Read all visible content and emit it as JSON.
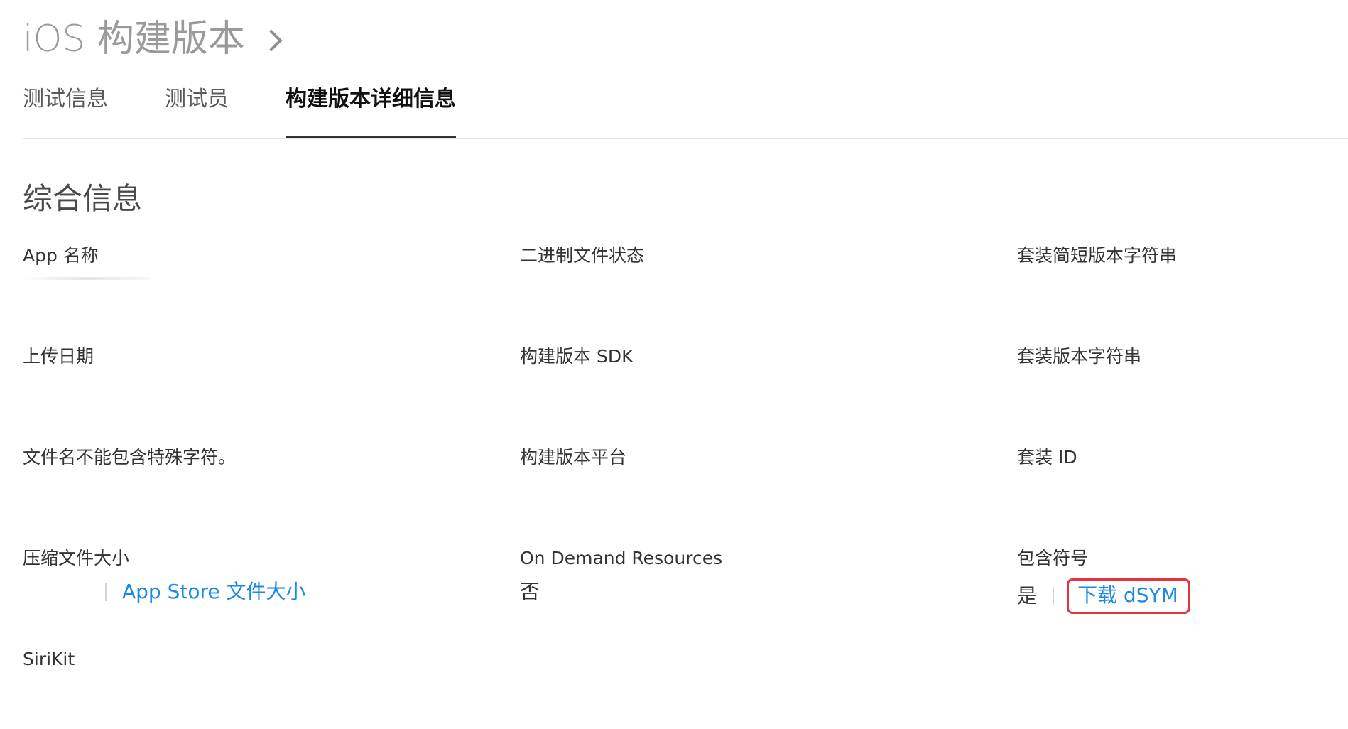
{
  "header": {
    "title": "iOS 构建版本"
  },
  "tabs": [
    {
      "label": "测试信息",
      "active": false
    },
    {
      "label": "测试员",
      "active": false
    },
    {
      "label": "构建版本详细信息",
      "active": true
    }
  ],
  "section": {
    "title": "综合信息"
  },
  "fields": {
    "app_name": {
      "label": "App 名称"
    },
    "binary_state": {
      "label": "二进制文件状态"
    },
    "short_version": {
      "label": "套装简短版本字符串"
    },
    "upload_date": {
      "label": "上传日期"
    },
    "build_sdk": {
      "label": "构建版本 SDK"
    },
    "bundle_version": {
      "label": "套装版本字符串"
    },
    "file_name": {
      "label": "文件名不能包含特殊字符。"
    },
    "build_platform": {
      "label": "构建版本平台"
    },
    "bundle_id": {
      "label": "套装 ID"
    },
    "compressed_size": {
      "label": "压缩文件大小",
      "link": "App Store 文件大小"
    },
    "on_demand": {
      "label": "On Demand Resources",
      "value": "否"
    },
    "symbols": {
      "label": "包含符号",
      "value": "是",
      "link": "下载 dSYM"
    },
    "sirikit": {
      "label": "SiriKit"
    }
  },
  "colors": {
    "link": "#1a8ae5",
    "highlight_border": "#e8323c",
    "title_gray": "#9a9a9a"
  }
}
